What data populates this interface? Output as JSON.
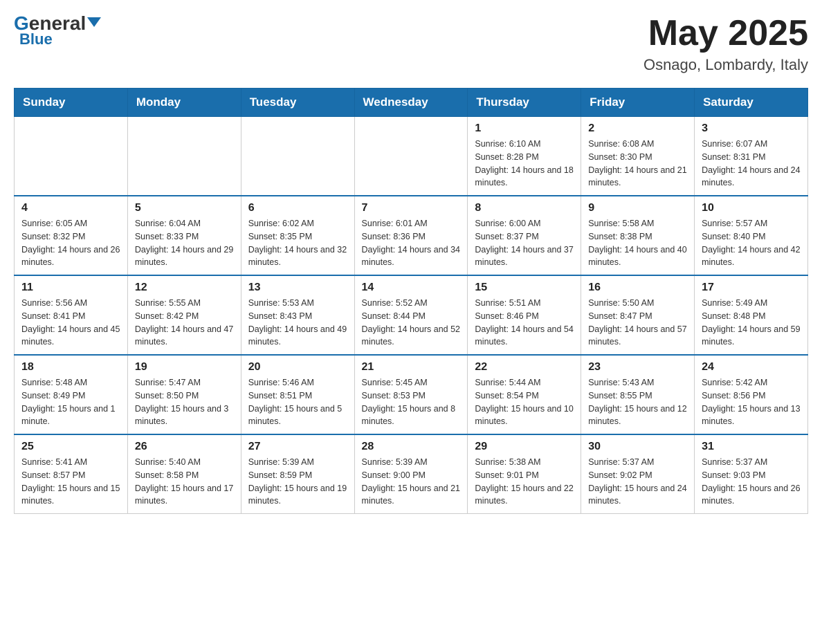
{
  "header": {
    "logo_general": "General",
    "logo_blue": "Blue",
    "title": "May 2025",
    "location": "Osnago, Lombardy, Italy"
  },
  "weekdays": [
    "Sunday",
    "Monday",
    "Tuesday",
    "Wednesday",
    "Thursday",
    "Friday",
    "Saturday"
  ],
  "weeks": [
    [
      {
        "day": "",
        "info": ""
      },
      {
        "day": "",
        "info": ""
      },
      {
        "day": "",
        "info": ""
      },
      {
        "day": "",
        "info": ""
      },
      {
        "day": "1",
        "info": "Sunrise: 6:10 AM\nSunset: 8:28 PM\nDaylight: 14 hours and 18 minutes."
      },
      {
        "day": "2",
        "info": "Sunrise: 6:08 AM\nSunset: 8:30 PM\nDaylight: 14 hours and 21 minutes."
      },
      {
        "day": "3",
        "info": "Sunrise: 6:07 AM\nSunset: 8:31 PM\nDaylight: 14 hours and 24 minutes."
      }
    ],
    [
      {
        "day": "4",
        "info": "Sunrise: 6:05 AM\nSunset: 8:32 PM\nDaylight: 14 hours and 26 minutes."
      },
      {
        "day": "5",
        "info": "Sunrise: 6:04 AM\nSunset: 8:33 PM\nDaylight: 14 hours and 29 minutes."
      },
      {
        "day": "6",
        "info": "Sunrise: 6:02 AM\nSunset: 8:35 PM\nDaylight: 14 hours and 32 minutes."
      },
      {
        "day": "7",
        "info": "Sunrise: 6:01 AM\nSunset: 8:36 PM\nDaylight: 14 hours and 34 minutes."
      },
      {
        "day": "8",
        "info": "Sunrise: 6:00 AM\nSunset: 8:37 PM\nDaylight: 14 hours and 37 minutes."
      },
      {
        "day": "9",
        "info": "Sunrise: 5:58 AM\nSunset: 8:38 PM\nDaylight: 14 hours and 40 minutes."
      },
      {
        "day": "10",
        "info": "Sunrise: 5:57 AM\nSunset: 8:40 PM\nDaylight: 14 hours and 42 minutes."
      }
    ],
    [
      {
        "day": "11",
        "info": "Sunrise: 5:56 AM\nSunset: 8:41 PM\nDaylight: 14 hours and 45 minutes."
      },
      {
        "day": "12",
        "info": "Sunrise: 5:55 AM\nSunset: 8:42 PM\nDaylight: 14 hours and 47 minutes."
      },
      {
        "day": "13",
        "info": "Sunrise: 5:53 AM\nSunset: 8:43 PM\nDaylight: 14 hours and 49 minutes."
      },
      {
        "day": "14",
        "info": "Sunrise: 5:52 AM\nSunset: 8:44 PM\nDaylight: 14 hours and 52 minutes."
      },
      {
        "day": "15",
        "info": "Sunrise: 5:51 AM\nSunset: 8:46 PM\nDaylight: 14 hours and 54 minutes."
      },
      {
        "day": "16",
        "info": "Sunrise: 5:50 AM\nSunset: 8:47 PM\nDaylight: 14 hours and 57 minutes."
      },
      {
        "day": "17",
        "info": "Sunrise: 5:49 AM\nSunset: 8:48 PM\nDaylight: 14 hours and 59 minutes."
      }
    ],
    [
      {
        "day": "18",
        "info": "Sunrise: 5:48 AM\nSunset: 8:49 PM\nDaylight: 15 hours and 1 minute."
      },
      {
        "day": "19",
        "info": "Sunrise: 5:47 AM\nSunset: 8:50 PM\nDaylight: 15 hours and 3 minutes."
      },
      {
        "day": "20",
        "info": "Sunrise: 5:46 AM\nSunset: 8:51 PM\nDaylight: 15 hours and 5 minutes."
      },
      {
        "day": "21",
        "info": "Sunrise: 5:45 AM\nSunset: 8:53 PM\nDaylight: 15 hours and 8 minutes."
      },
      {
        "day": "22",
        "info": "Sunrise: 5:44 AM\nSunset: 8:54 PM\nDaylight: 15 hours and 10 minutes."
      },
      {
        "day": "23",
        "info": "Sunrise: 5:43 AM\nSunset: 8:55 PM\nDaylight: 15 hours and 12 minutes."
      },
      {
        "day": "24",
        "info": "Sunrise: 5:42 AM\nSunset: 8:56 PM\nDaylight: 15 hours and 13 minutes."
      }
    ],
    [
      {
        "day": "25",
        "info": "Sunrise: 5:41 AM\nSunset: 8:57 PM\nDaylight: 15 hours and 15 minutes."
      },
      {
        "day": "26",
        "info": "Sunrise: 5:40 AM\nSunset: 8:58 PM\nDaylight: 15 hours and 17 minutes."
      },
      {
        "day": "27",
        "info": "Sunrise: 5:39 AM\nSunset: 8:59 PM\nDaylight: 15 hours and 19 minutes."
      },
      {
        "day": "28",
        "info": "Sunrise: 5:39 AM\nSunset: 9:00 PM\nDaylight: 15 hours and 21 minutes."
      },
      {
        "day": "29",
        "info": "Sunrise: 5:38 AM\nSunset: 9:01 PM\nDaylight: 15 hours and 22 minutes."
      },
      {
        "day": "30",
        "info": "Sunrise: 5:37 AM\nSunset: 9:02 PM\nDaylight: 15 hours and 24 minutes."
      },
      {
        "day": "31",
        "info": "Sunrise: 5:37 AM\nSunset: 9:03 PM\nDaylight: 15 hours and 26 minutes."
      }
    ]
  ]
}
